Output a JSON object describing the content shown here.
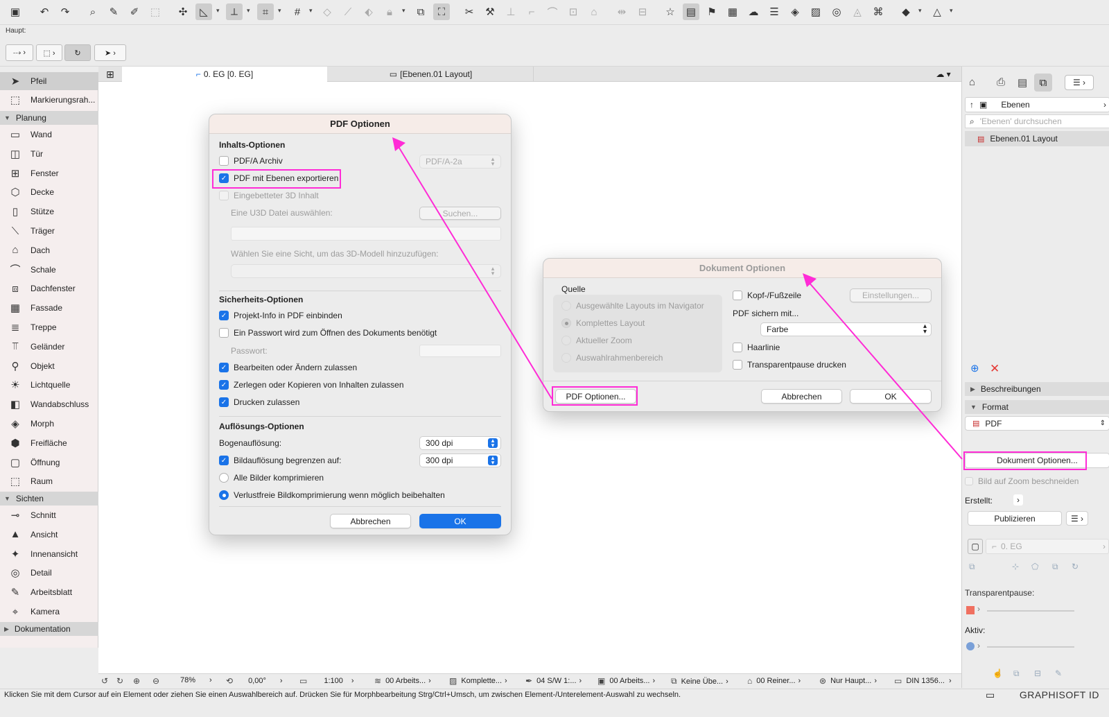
{
  "toolbar": {
    "groups": [
      "save-icon",
      "undo-icon",
      "redo-icon",
      "eyedropper-icon",
      "syringe-icon",
      "magic-wand-icon",
      "fit-icon",
      "cursor-snap-icon",
      "guides-icon",
      "snap-icon",
      "grid-icon",
      "plane-icon",
      "trace-icon",
      "wall-tool-icon",
      "lock-icon",
      "scale-icon",
      "fit-selection-icon",
      "scissors-icon",
      "hammer-icon",
      "elevate-icon",
      "corner-icon",
      "curve-icon",
      "explode-icon",
      "house-icon",
      "resize-icon",
      "split-icon",
      "favorite-icon",
      "layout-icon",
      "flag-icon",
      "doc-icon",
      "cloud-icon",
      "teamwork-icon",
      "layers-icon",
      "image-icon",
      "lens-icon",
      "map-icon",
      "tag-icon",
      "view-icon",
      "shape-icon"
    ]
  },
  "infobox": {
    "label": "Haupt:"
  },
  "toolbox": {
    "tools_top": [
      {
        "label": "Pfeil",
        "icon": "arrow-icon"
      },
      {
        "label": "Markierungsrah...",
        "icon": "marquee-icon"
      }
    ],
    "groups": {
      "planung": "Planung",
      "sichten": "Sichten",
      "dokumentation": "Dokumentation"
    },
    "planung_tools": [
      "Wand",
      "Tür",
      "Fenster",
      "Decke",
      "Stütze",
      "Träger",
      "Dach",
      "Schale",
      "Dachfenster",
      "Fassade",
      "Treppe",
      "Geländer",
      "Objekt",
      "Lichtquelle",
      "Wandabschluss",
      "Morph",
      "Freifläche",
      "Öffnung",
      "Raum"
    ],
    "sichten_tools": [
      "Schnitt",
      "Ansicht",
      "Innenansicht",
      "Detail",
      "Arbeitsblatt",
      "Kamera"
    ]
  },
  "tabs": {
    "tab1": "0. EG [0. EG]",
    "tab2": "[Ebenen.01 Layout]"
  },
  "pdf_dialog": {
    "title": "PDF Optionen",
    "content_section": "Inhalts-Optionen",
    "pdfa_label": "PDF/A Archiv",
    "pdfa_value": "PDF/A-2a",
    "layers_label": "PDF mit Ebenen exportieren",
    "embedded3d_label": "Eingebetteter 3D Inhalt",
    "u3d_label": "Eine U3D Datei auswählen:",
    "search_button": "Suchen...",
    "view_label": "Wählen Sie eine Sicht, um das 3D-Modell hinzuzufügen:",
    "security_section": "Sicherheits-Optionen",
    "projectinfo_label": "Projekt-Info in PDF einbinden",
    "password_req_label": "Ein Passwort wird zum Öffnen des Dokuments benötigt",
    "password_label": "Passwort:",
    "edit_label": "Bearbeiten oder Ändern zulassen",
    "copy_label": "Zerlegen oder Kopieren von Inhalten zulassen",
    "print_label": "Drucken zulassen",
    "resolution_section": "Auflösungs-Optionen",
    "arc_label": "Bogenauflösung:",
    "arc_value": "300 dpi",
    "image_limit_label": "Bildauflösung begrenzen auf:",
    "image_limit_value": "300 dpi",
    "compress_all_label": "Alle Bilder komprimieren",
    "lossless_label": "Verlustfreie Bildkomprimierung wenn möglich beibehalten",
    "cancel": "Abbrechen",
    "ok": "OK"
  },
  "doc_dialog": {
    "title": "Dokument Optionen",
    "source_label": "Quelle",
    "source_options": [
      "Ausgewählte Layouts im Navigator",
      "Komplettes Layout",
      "Aktueller Zoom",
      "Auswahlrahmenbereich"
    ],
    "header_footer_label": "Kopf-/Fußzeile",
    "settings_button": "Einstellungen...",
    "save_with_label": "PDF sichern mit...",
    "save_with_value": "Farbe",
    "hairline_label": "Haarlinie",
    "transparent_label": "Transparentpause drucken",
    "pdf_options_button": "PDF Optionen...",
    "cancel": "Abbrechen",
    "ok": "OK"
  },
  "right_panel": {
    "dropdown": "Ebenen",
    "search_placeholder": "'Ebenen' durchsuchen",
    "item": "Ebenen.01 Layout",
    "descriptions": "Beschreibungen",
    "format_header": "Format",
    "format_value": "PDF",
    "doc_options_button": "Dokument Optionen...",
    "crop_label": "Bild auf Zoom beschneiden",
    "created_label": "Erstellt:",
    "publish_button": "Publizieren",
    "story_label": "0. EG",
    "transparent_label": "Transparentpause:",
    "active_label": "Aktiv:"
  },
  "status": {
    "zoom": "78%",
    "angle": "0,00°",
    "scale": "1:100",
    "layer_combo": "00 Arbeits...",
    "layout": "Komplette...",
    "pen_set": "04 S/W 1:...",
    "model_view": "00 Arbeits...",
    "override": "Keine Übe...",
    "renovation": "00 Reiner...",
    "structure": "Nur Haupt...",
    "dimension": "DIN 1356..."
  },
  "hint": "Klicken Sie mit dem Cursor auf ein Element oder ziehen Sie einen Auswahlbereich auf. Drücken Sie für Morphbearbeitung Strg/Ctrl+Umsch, um zwischen Element-/Unterelement-Auswahl zu wechseln.",
  "brand": "GRAPHISOFT ID",
  "colors": {
    "accent": "#1a73e8",
    "annotation": "#ff2bd6",
    "dialog_title_bg": "#f6ece8"
  }
}
